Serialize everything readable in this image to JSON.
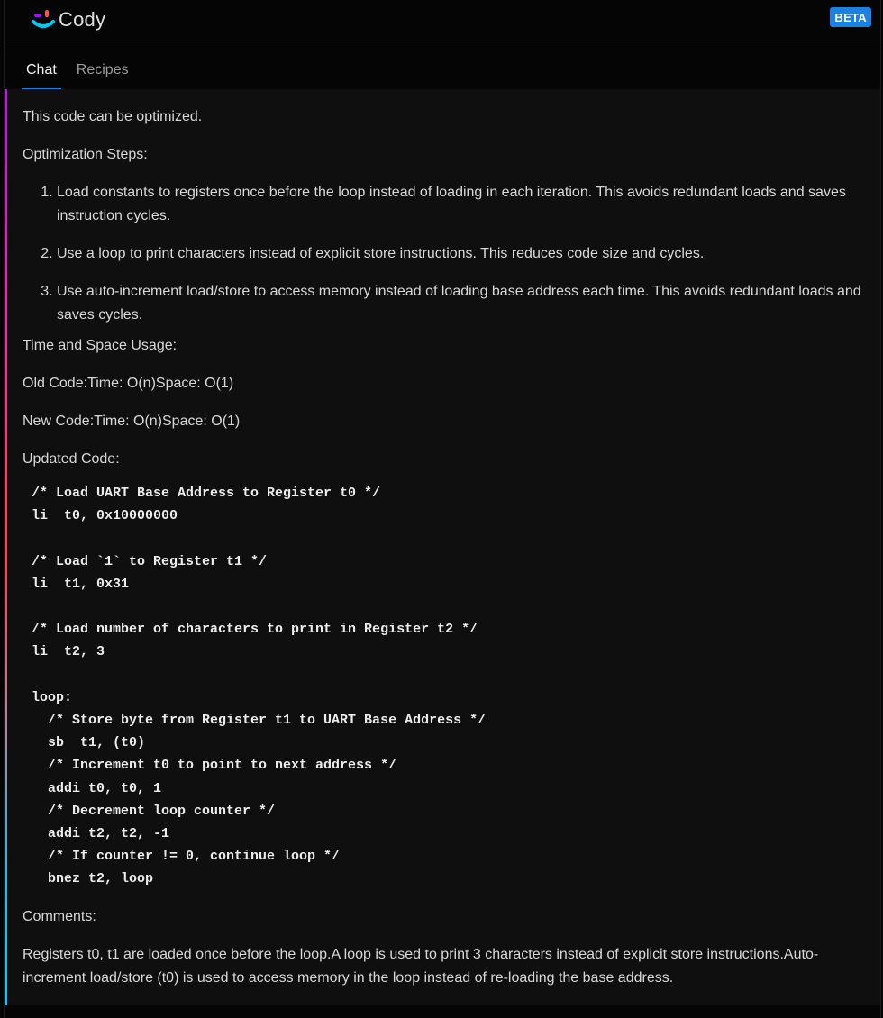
{
  "header": {
    "app_name": "Cody",
    "badge": "BETA",
    "logo_icon": "cody-smile-logo-icon"
  },
  "tabs": [
    {
      "label": "Chat",
      "active": true
    },
    {
      "label": "Recipes",
      "active": false
    }
  ],
  "colors": {
    "accent": "#1a82e2",
    "background": "#0f0f0f",
    "header_background": "#050505",
    "text": "#d8d8d8",
    "gradient_top": "#b31ed6",
    "gradient_middle": "#f5455c",
    "gradient_bottom": "#16c3ea"
  },
  "message": {
    "intro": "This code can be optimized.",
    "steps_heading": "Optimization Steps:",
    "steps": [
      "Load constants to registers once before the loop instead of loading in each iteration. This avoids redundant loads and saves instruction cycles.",
      "Use a loop to print characters instead of explicit store instructions. This reduces code size and cycles.",
      "Use auto-increment load/store to access memory instead of loading base address each time. This avoids redundant loads and saves cycles."
    ],
    "usage_heading": "Time and Space Usage:",
    "old_code": "Old Code:Time: O(n)Space: O(1)",
    "new_code": "New Code:Time: O(n)Space: O(1)",
    "updated_heading": "Updated Code:",
    "code": "/* Load UART Base Address to Register t0 */\nli  t0, 0x10000000\n\n/* Load `1` to Register t1 */\nli  t1, 0x31\n\n/* Load number of characters to print in Register t2 */\nli  t2, 3\n\nloop:\n  /* Store byte from Register t1 to UART Base Address */\n  sb  t1, (t0)\n  /* Increment t0 to point to next address */\n  addi t0, t0, 1\n  /* Decrement loop counter */\n  addi t2, t2, -1\n  /* If counter != 0, continue loop */\n  bnez t2, loop",
    "comments_heading": "Comments:",
    "comments": "Registers t0, t1 are loaded once before the loop.A loop is used to print 3 characters instead of explicit store instructions.Auto-increment load/store (t0) is used to access memory in the loop instead of re-loading the base address."
  }
}
